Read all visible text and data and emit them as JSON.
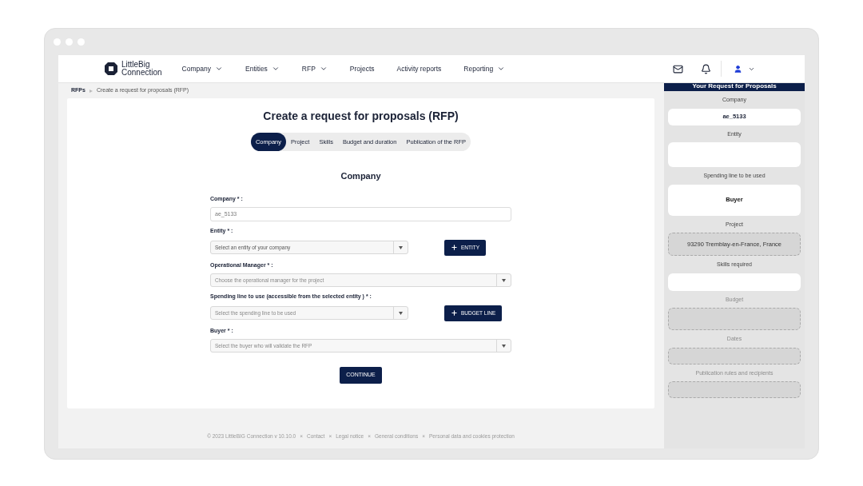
{
  "logo": {
    "lines": [
      "LittleBig",
      "Connection"
    ]
  },
  "nav": [
    {
      "label": "Company",
      "kind": "dropdown"
    },
    {
      "label": "Entities",
      "kind": "dropdown"
    },
    {
      "label": "RFP",
      "kind": "dropdown"
    },
    {
      "label": "Projects",
      "kind": "link"
    },
    {
      "label": "Activity reports",
      "kind": "link"
    },
    {
      "label": "Reporting",
      "kind": "dropdown"
    }
  ],
  "breadcrumb": [
    {
      "label": "RFPs",
      "current": false
    },
    {
      "label": "Create a request for proposals (RFP)",
      "current": true
    }
  ],
  "form": {
    "title": "Create a request for proposals (RFP)",
    "steps": [
      {
        "label": "Company",
        "selected": true
      },
      {
        "label": "Project",
        "selected": false
      },
      {
        "label": "Skills",
        "selected": false
      },
      {
        "label": "Budget and duration",
        "selected": false
      },
      {
        "label": "Publication of the RFP",
        "selected": false
      }
    ],
    "section_title": "Company",
    "fields": [
      {
        "kind": "text",
        "label": "Company * :",
        "value": "ae_5133",
        "disabled": true
      },
      {
        "kind": "select",
        "label": "Entity * :",
        "placeholder": "Select an entity of your company",
        "button": "ENTITY"
      },
      {
        "kind": "select",
        "label": "Operational Manager * :",
        "placeholder": "Choose the operational manager for the project"
      },
      {
        "kind": "select",
        "label": "Spending line to use (accessible from the selected entity ) * :",
        "placeholder": "Select the spending line to be used",
        "button": "BUDGET LINE"
      },
      {
        "kind": "select",
        "label": "Buyer * :",
        "placeholder": "Select the buyer who will validate the RFP"
      }
    ],
    "submit": "CONTINUE"
  },
  "summary": {
    "title": "Your Request for Proposals",
    "items": [
      {
        "label": "Company",
        "value": "ae_5133",
        "kind": "filled",
        "disabled": false
      },
      {
        "label": "Entity",
        "kind": "filled",
        "disabled": false
      },
      {
        "label": "Spending line to be used",
        "value": "Buyer",
        "kind": "filled",
        "disabled": false
      },
      {
        "label": "Project",
        "value": "93290 Tremblay-en-France, France",
        "kind": "dashed",
        "disabled": false
      },
      {
        "label": "Skills required",
        "kind": "filled",
        "disabled": false
      },
      {
        "label": "Budget",
        "kind": "dashed",
        "disabled": true
      },
      {
        "label": "Dates",
        "kind": "dashed",
        "disabled": true
      },
      {
        "label": "Publication rules and recipients",
        "kind": "dashed",
        "disabled": true
      }
    ]
  },
  "footer_separator": "×",
  "footer": [
    "© 2023 LittleBIG Connection v 10.10.0",
    "Contact",
    "Legal notice",
    "General conditions",
    "Personal data and cookies protection"
  ]
}
